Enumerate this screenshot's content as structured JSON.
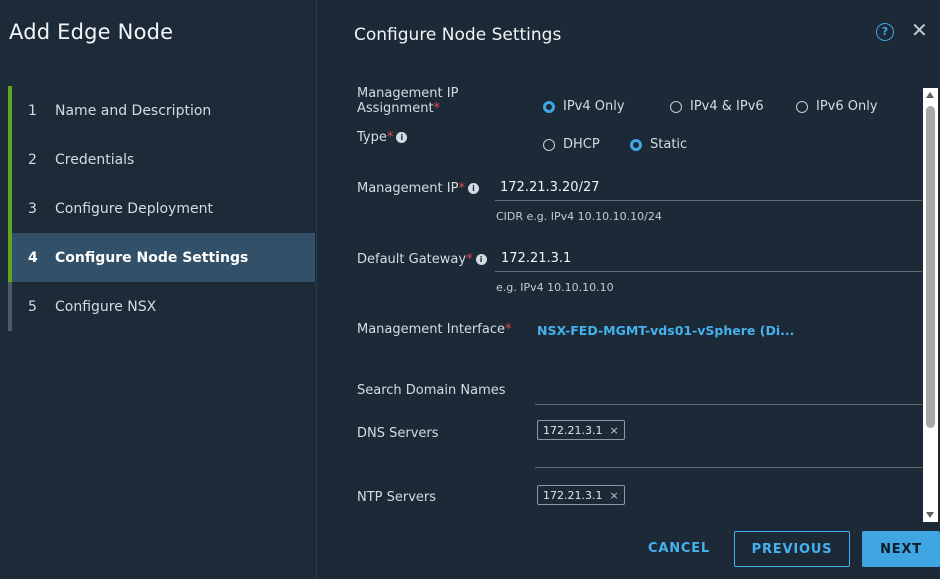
{
  "wizard": {
    "title": "Add Edge Node",
    "steps": [
      {
        "num": "1",
        "label": "Name and Description"
      },
      {
        "num": "2",
        "label": "Credentials"
      },
      {
        "num": "3",
        "label": "Configure Deployment"
      },
      {
        "num": "4",
        "label": "Configure Node Settings"
      },
      {
        "num": "5",
        "label": "Configure NSX"
      }
    ]
  },
  "panel": {
    "title": "Configure Node Settings",
    "help_glyph": "?",
    "close_glyph": "✕"
  },
  "form": {
    "mgmt_ip_assignment": {
      "label_line1": "Management IP",
      "label_line2": "Assignment",
      "options": [
        "IPv4 Only",
        "IPv4 & IPv6",
        "IPv6 Only"
      ],
      "selected": "IPv4 Only"
    },
    "type": {
      "label": "Type",
      "options": [
        "DHCP",
        "Static"
      ],
      "selected": "Static"
    },
    "mgmt_ip": {
      "label": "Management IP",
      "value": "172.21.3.20/27",
      "hint": "CIDR e.g. IPv4 10.10.10.10/24"
    },
    "default_gateway": {
      "label": "Default Gateway",
      "value": "172.21.3.1",
      "hint": "e.g. IPv4 10.10.10.10"
    },
    "mgmt_interface": {
      "label": "Management Interface",
      "value": "NSX-FED-MGMT-vds01-vSphere (Di..."
    },
    "search_domain": {
      "label": "Search Domain Names",
      "value": ""
    },
    "dns_servers": {
      "label": "DNS Servers",
      "tags": [
        "172.21.3.1"
      ]
    },
    "ntp_servers": {
      "label": "NTP Servers",
      "tags": [
        "172.21.3.1"
      ]
    },
    "required_mark": "*",
    "info_glyph": "i",
    "tag_remove_glyph": "×"
  },
  "buttons": {
    "cancel": "CANCEL",
    "previous": "PREVIOUS",
    "next": "NEXT"
  },
  "colors": {
    "accent": "#3fa6e3",
    "completed_step": "#62a420",
    "required": "#e34a4a",
    "active_step_bg": "#325068"
  }
}
